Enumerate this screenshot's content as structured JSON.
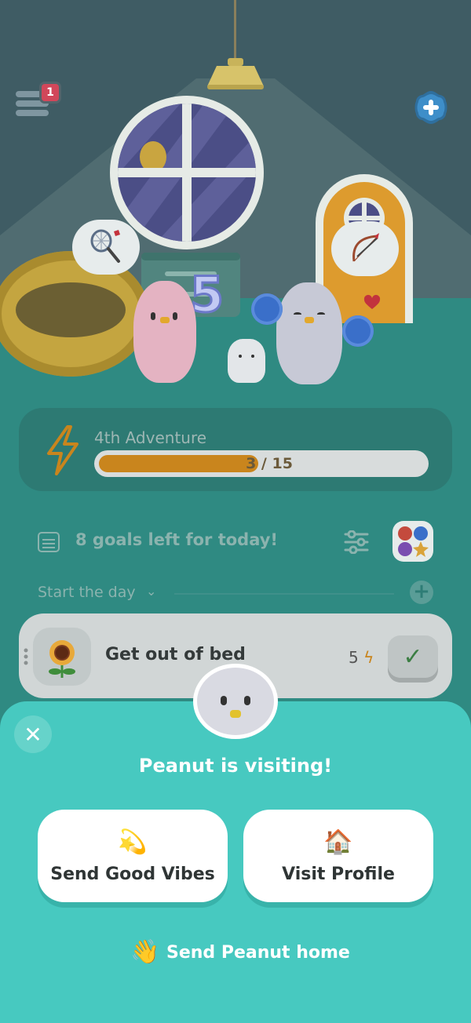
{
  "header": {
    "menu_badge": "1",
    "menu_icon": "menu-icon",
    "add_icon": "plus-icon"
  },
  "scene": {
    "window_decoration": "round-window",
    "bubble_left_icon": "badminton-racket-icon",
    "bubble_right_icon": "bow-and-arrow-icon",
    "balloon_number": "5"
  },
  "adventure": {
    "title": "4th Adventure",
    "progress_text": "3 / 15",
    "progress_value": 3,
    "progress_max": 15,
    "icon": "lightning-bolt-icon"
  },
  "goals": {
    "summary": "8 goals left for today!",
    "section_label": "Start the day",
    "section_toggle": "⌄",
    "add_label": "+"
  },
  "task": {
    "title": "Get out of bed",
    "points": "5",
    "icon": "sunflower-icon",
    "check": "✓"
  },
  "visit_sheet": {
    "close": "✕",
    "title": "Peanut is visiting!",
    "good_vibes_emoji": "💫",
    "good_vibes_label": "Send Good Vibes",
    "profile_emoji": "🏠",
    "profile_label": "Visit Profile",
    "home_emoji": "👋",
    "home_label": "Send Peanut home"
  },
  "colors": {
    "sheet": "#47c9c0",
    "accent_orange": "#c9851d",
    "check_green": "#3b7e43"
  }
}
